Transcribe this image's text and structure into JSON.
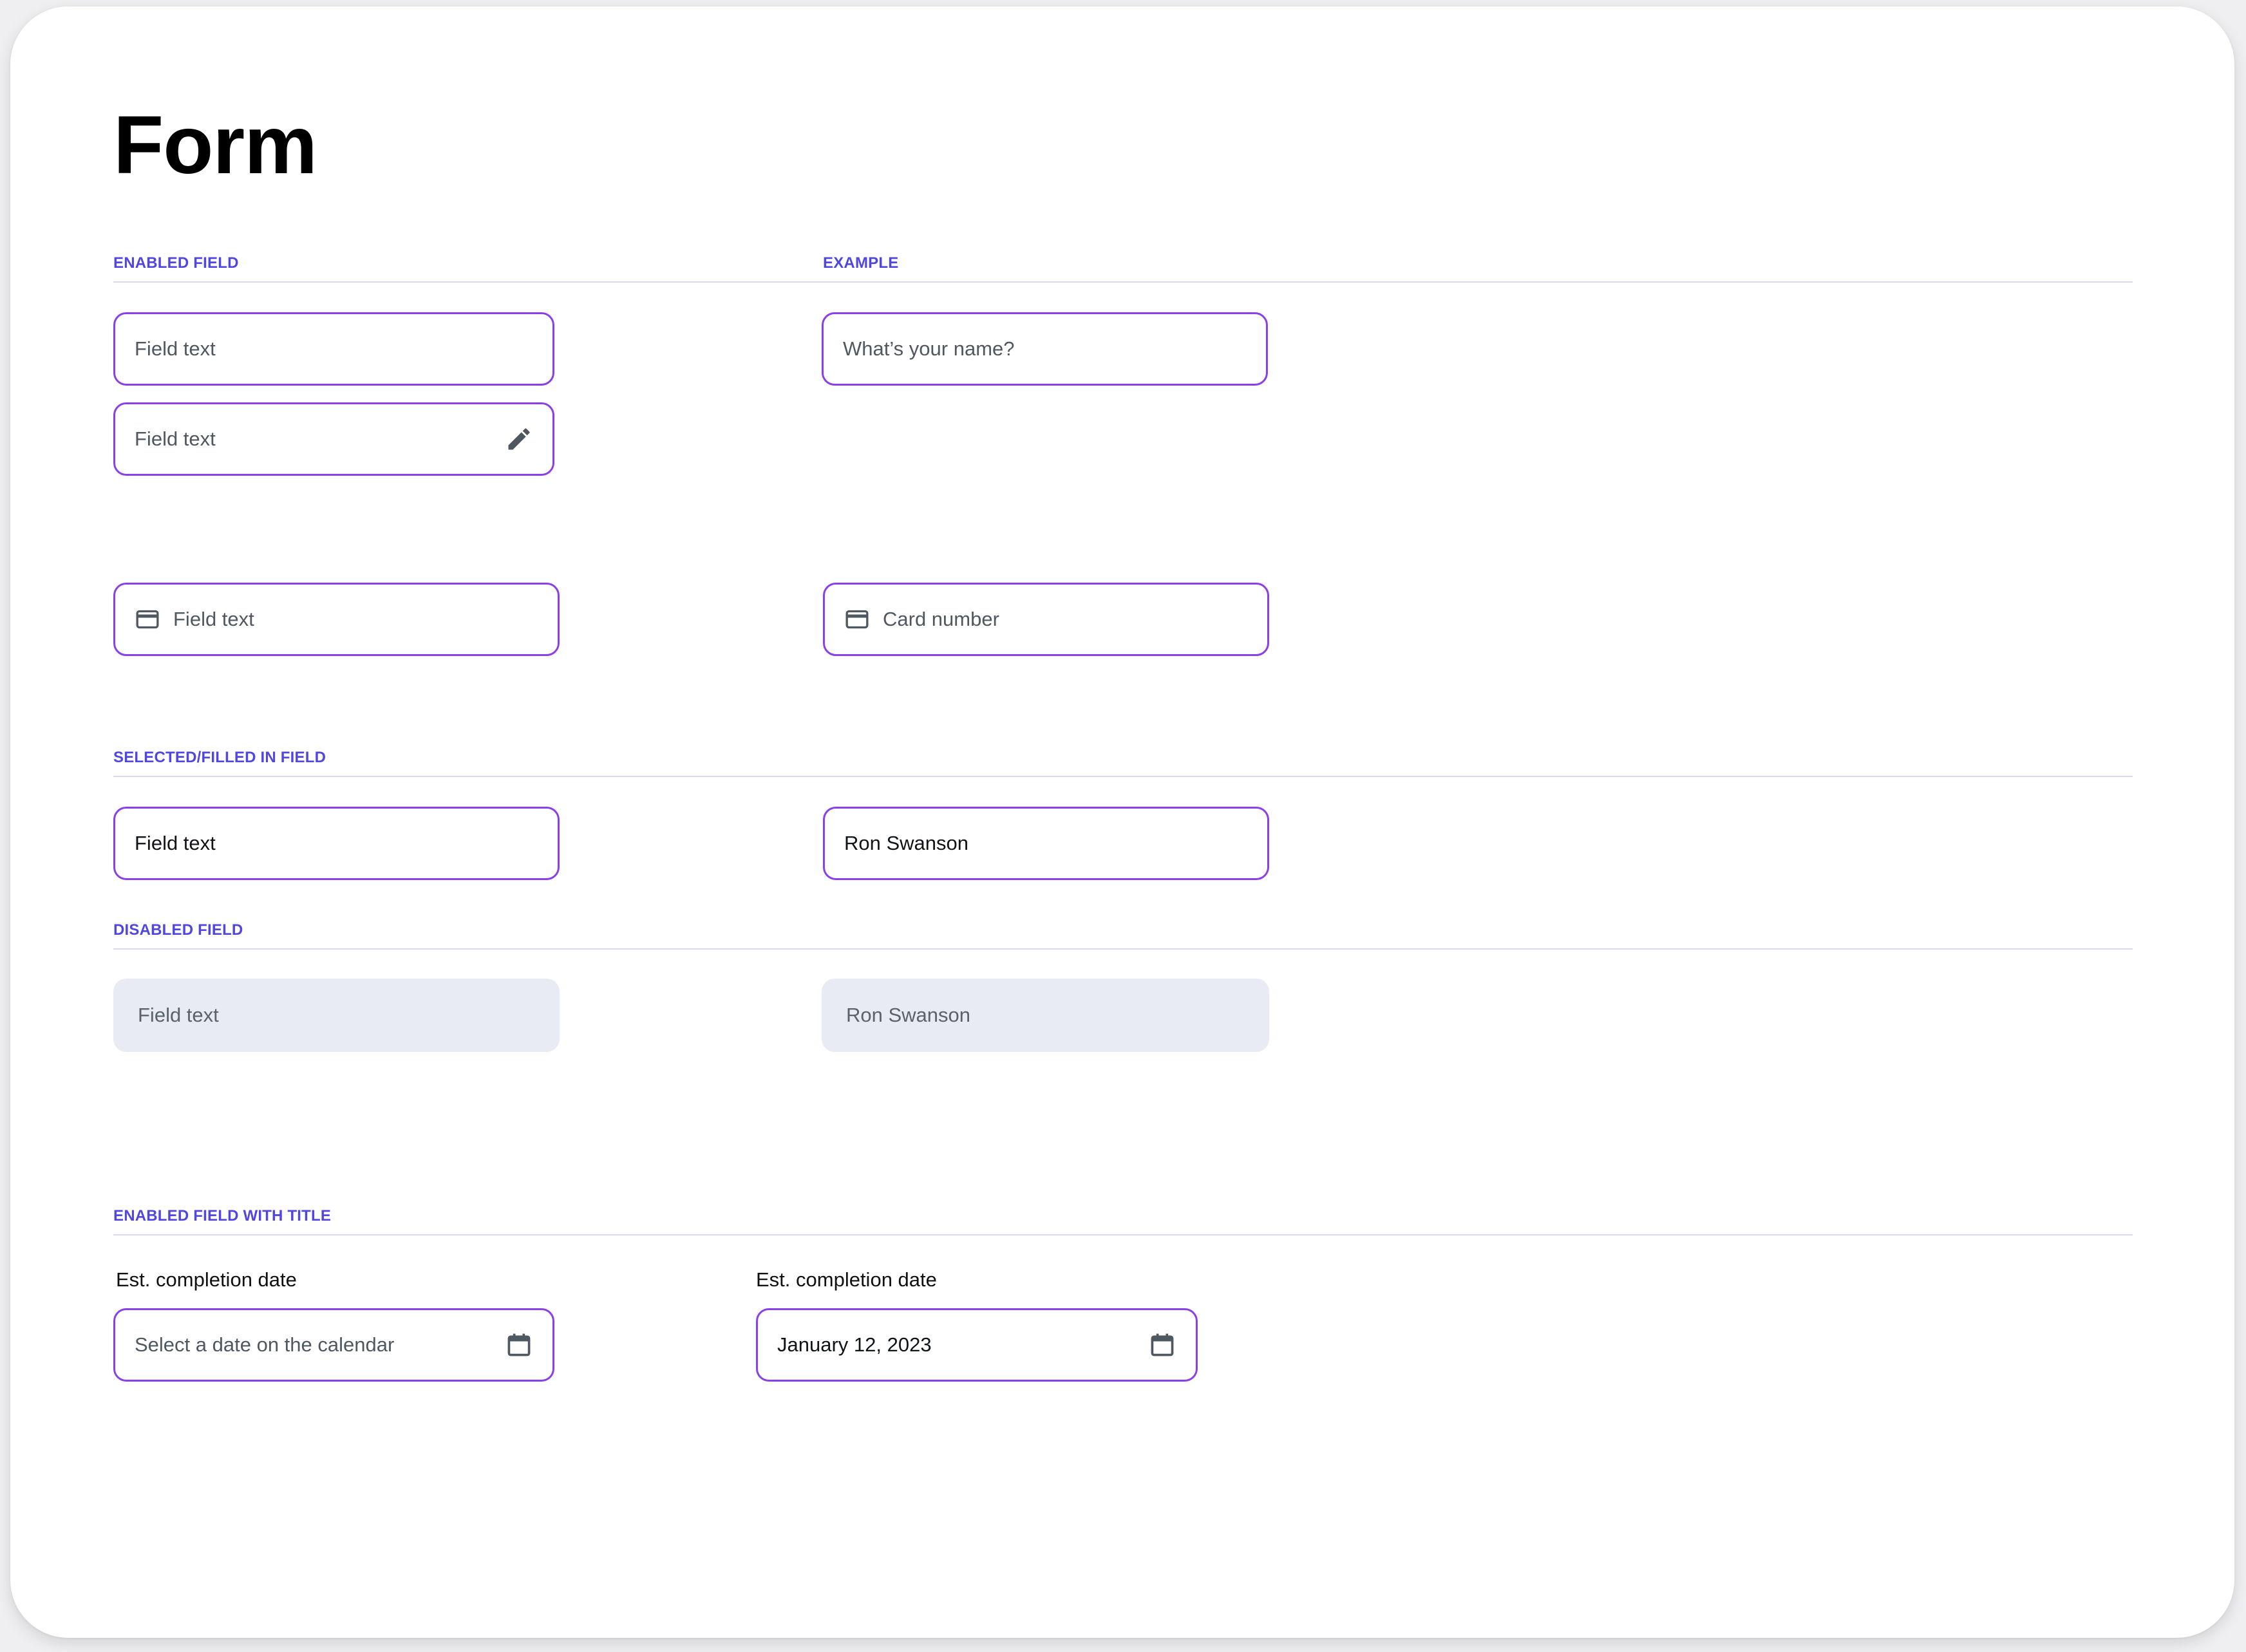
{
  "page": {
    "title": "Form"
  },
  "colors": {
    "accent": "#5046e0",
    "field_border": "#8b3fe8",
    "disabled_bg": "#e8ebf3",
    "rule": "#d9d7f4"
  },
  "sections": {
    "enabled": {
      "label": "ENABLED FIELD",
      "example_label": "EXAMPLE",
      "field_1": "Field text",
      "field_2": "Field text",
      "field_2_icon": "pencil-icon",
      "field_3": "Field text",
      "field_3_icon": "credit-card-icon",
      "example_1": "What’s your name?",
      "example_2": "Card number",
      "example_2_icon": "credit-card-icon"
    },
    "selected": {
      "label": "SELECTED/FILLED IN FIELD",
      "field": "Field text",
      "example": "Ron Swanson"
    },
    "disabled": {
      "label": "DISABLED FIELD",
      "field": "Field text",
      "example": "Ron Swanson"
    },
    "with_title": {
      "label": "ENABLED FIELD WITH TITLE",
      "field_title": "Est. completion date",
      "field_placeholder": "Select a date on the calendar",
      "field_icon": "calendar-icon",
      "example_title": "Est. completion date",
      "example_value": "January 12, 2023",
      "example_icon": "calendar-icon"
    }
  }
}
